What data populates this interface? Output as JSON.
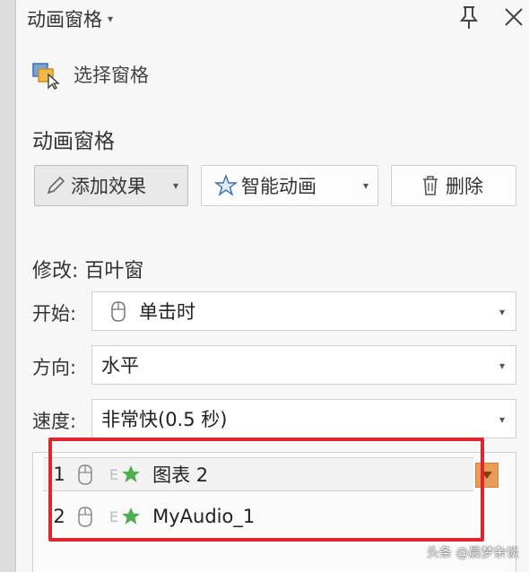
{
  "header": {
    "title": "动画窗格",
    "caret": "▾"
  },
  "select_pane": {
    "label": "选择窗格"
  },
  "section": {
    "title": "动画窗格"
  },
  "toolbar": {
    "add_effect": "添加效果",
    "smart_animation": "智能动画",
    "delete": "删除"
  },
  "modify": {
    "label": "修改: 百叶窗"
  },
  "fields": {
    "start": {
      "label": "开始:",
      "value": "单击时"
    },
    "direction": {
      "label": "方向:",
      "value": "水平"
    },
    "speed": {
      "label": "速度:",
      "value": "非常快(0.5 秒)"
    }
  },
  "animation_list": [
    {
      "num": "1",
      "e": "E",
      "name": "图表 2"
    },
    {
      "num": "2",
      "e": "E",
      "name": "MyAudio_1"
    }
  ],
  "watermark": "头条 @晨梦杂谈",
  "colors": {
    "highlight_frame": "#e0262c",
    "dropdown_orange": "#e89c58",
    "star_green": "#4caf50"
  }
}
